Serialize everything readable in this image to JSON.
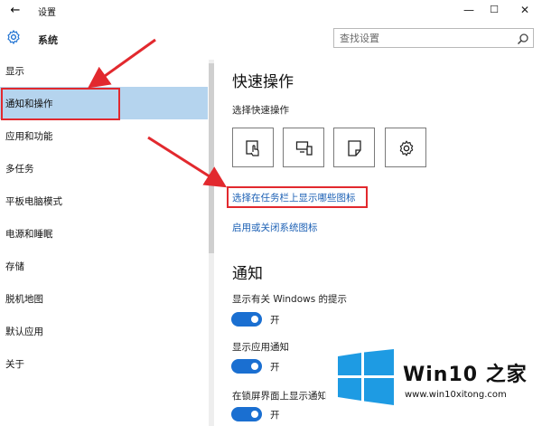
{
  "window": {
    "back_symbol": "←",
    "title": "设置",
    "minimize_symbol": "—",
    "maximize_symbol": "☐",
    "close_symbol": "✕"
  },
  "header": {
    "section_title": "系统",
    "search_placeholder": "查找设置"
  },
  "sidebar": {
    "items": [
      {
        "label": "显示"
      },
      {
        "label": "通知和操作",
        "selected": true
      },
      {
        "label": "应用和功能"
      },
      {
        "label": "多任务"
      },
      {
        "label": "平板电脑模式"
      },
      {
        "label": "电源和睡眠"
      },
      {
        "label": "存储"
      },
      {
        "label": "脱机地图"
      },
      {
        "label": "默认应用"
      },
      {
        "label": "关于"
      }
    ]
  },
  "quick_actions": {
    "title": "快速操作",
    "subtitle": "选择快速操作",
    "tiles": [
      {
        "icon": "tablet-mode-icon"
      },
      {
        "icon": "project-display-icon"
      },
      {
        "icon": "note-icon"
      },
      {
        "icon": "settings-gear-icon"
      }
    ],
    "link_taskbar_icons": "选择在任务栏上显示哪些图标",
    "link_system_icons": "启用或关闭系统图标"
  },
  "notifications": {
    "title": "通知",
    "options": [
      {
        "label": "显示有关 Windows 的提示",
        "state": "开"
      },
      {
        "label": "显示应用通知",
        "state": "开"
      },
      {
        "label": "在锁屏界面上显示通知",
        "state": "开"
      }
    ]
  },
  "watermark": {
    "brand": "Win10 之家",
    "url": "www.win10xitong.com"
  },
  "colors": {
    "accent": "#1a6fd1",
    "selected_bg": "#b5d4ee",
    "annotation_red": "#e2292e",
    "link": "#1a5fb4"
  }
}
